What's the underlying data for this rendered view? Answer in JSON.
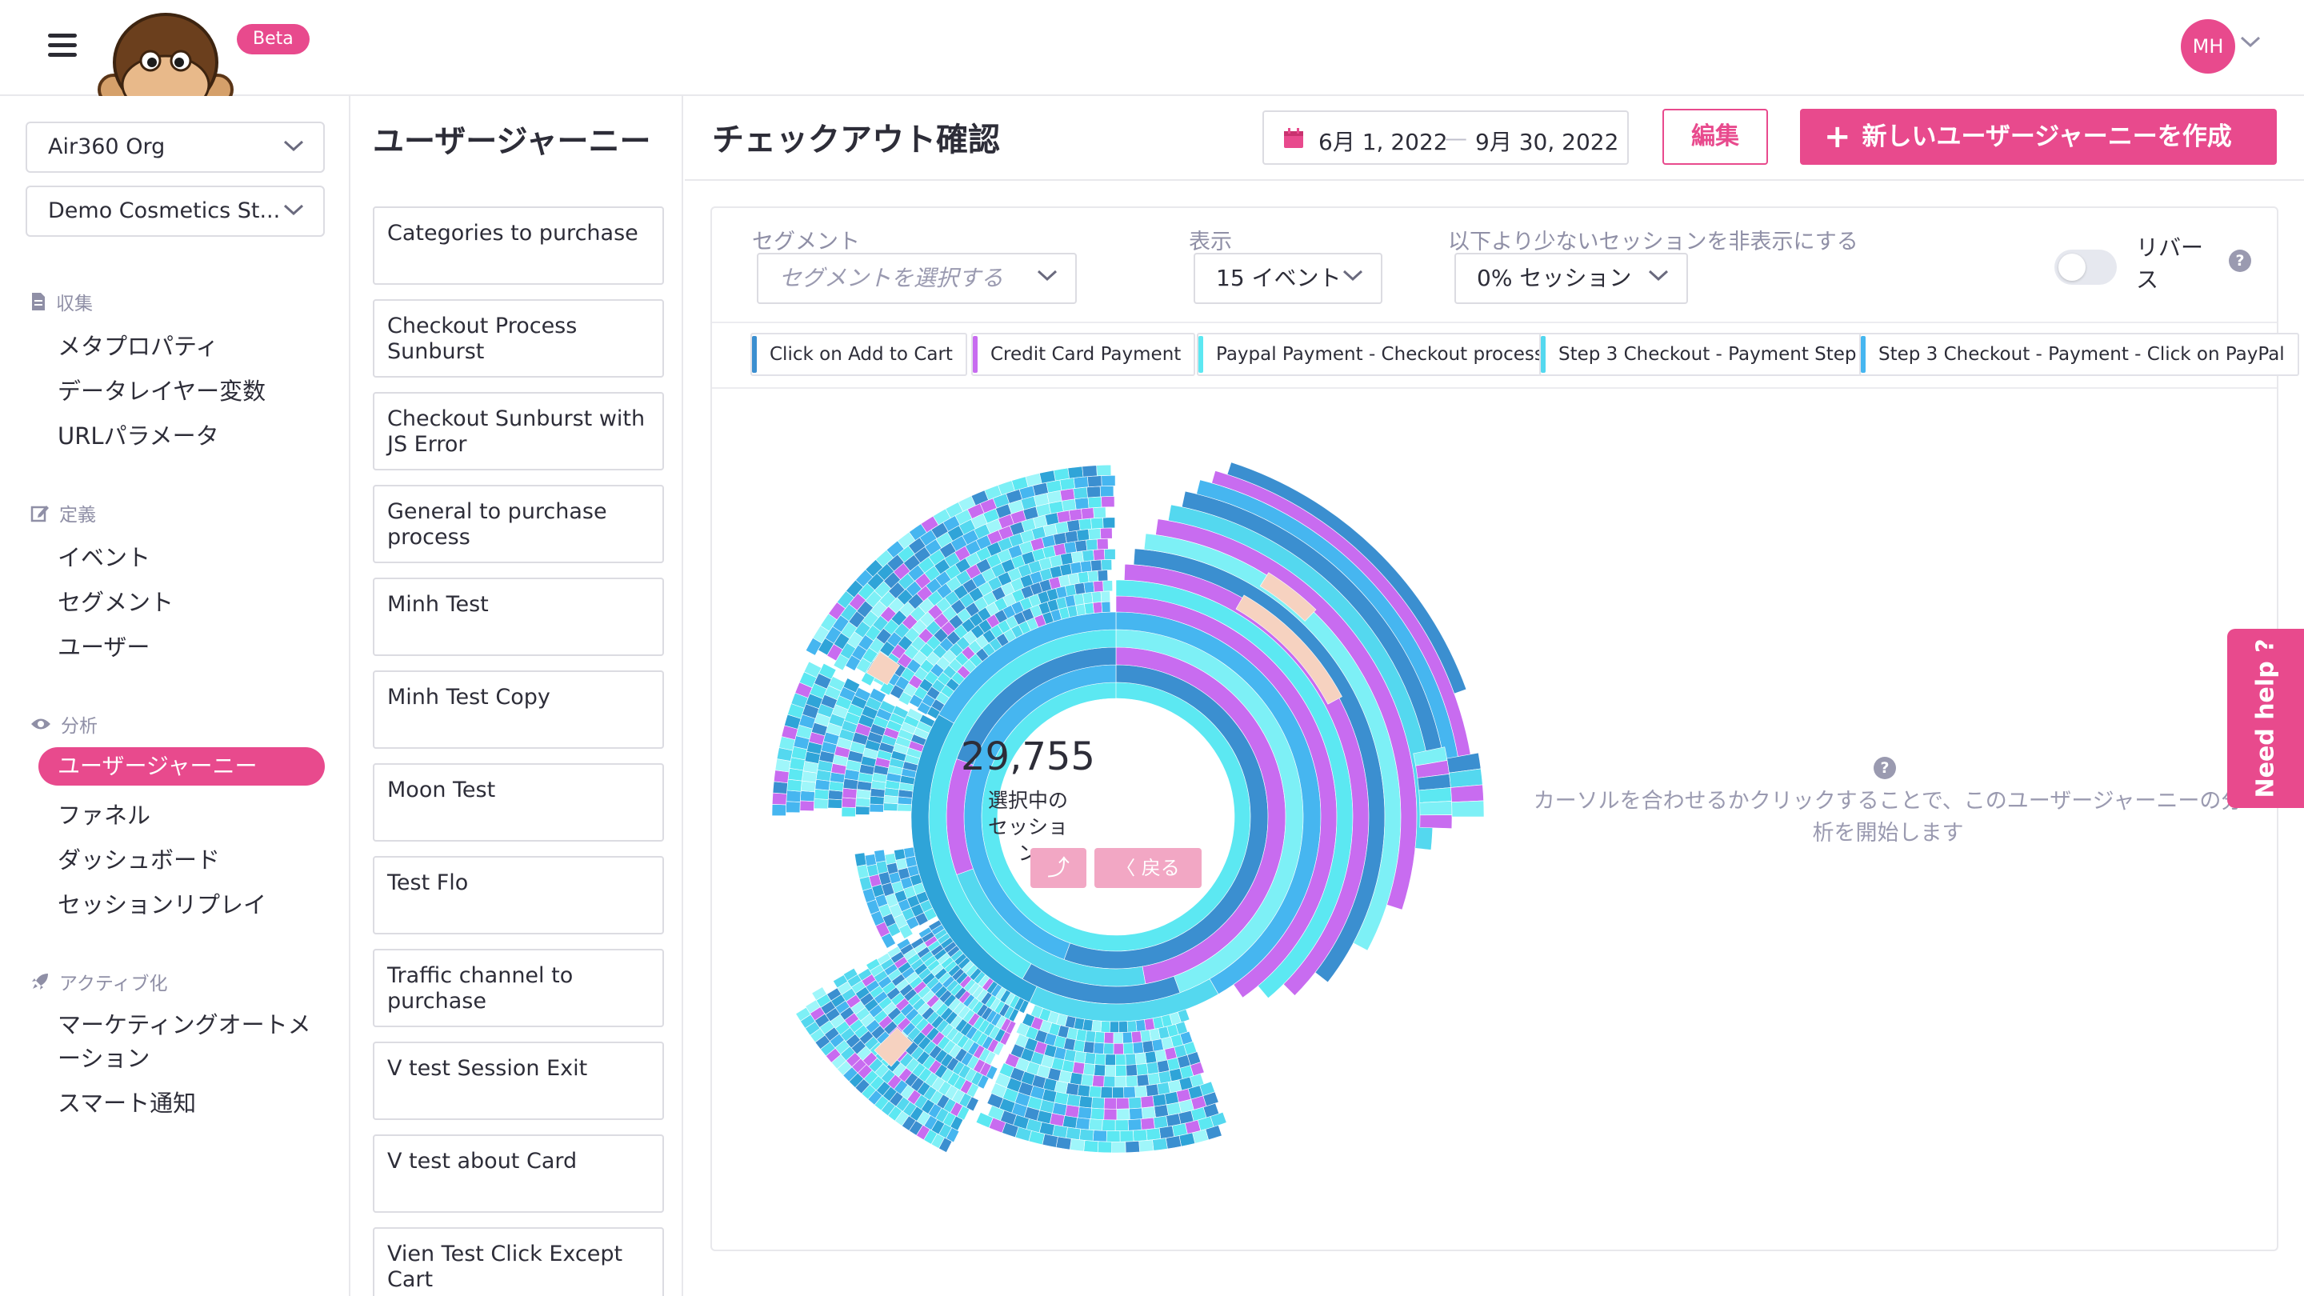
{
  "brand": {
    "badge": "Beta",
    "accent_color": "#e84a8d"
  },
  "user": {
    "initials": "MH"
  },
  "sidebar": {
    "org_select": "Air360 Org",
    "site_select": "Demo Cosmetics St...",
    "sections": [
      {
        "title": "収集",
        "icon": "document-icon",
        "items": [
          "メタプロパティ",
          "データレイヤー変数",
          "URLパラメータ"
        ]
      },
      {
        "title": "定義",
        "icon": "edit-icon",
        "items": [
          "イベント",
          "セグメント",
          "ユーザー"
        ]
      },
      {
        "title": "分析",
        "icon": "eye-icon",
        "items": [
          "ユーザージャーニー",
          "ファネル",
          "ダッシュボード",
          "セッションリプレイ"
        ],
        "active": "ユーザージャーニー"
      },
      {
        "title": "アクティブ化",
        "icon": "rocket-icon",
        "items": [
          "マーケティングオートメーション",
          "スマート通知"
        ]
      }
    ]
  },
  "journeys": {
    "title": "ユーザージャーニー",
    "items": [
      "Categories to purchase",
      "Checkout Process Sunburst",
      "Checkout Sunburst with JS Error",
      "General to purchase process",
      "Minh Test",
      "Minh Test Copy",
      "Moon Test",
      "Test Flo",
      "Traffic channel to purchase",
      "V test Session Exit",
      "V test about Card",
      "Vien Test Click Except Cart"
    ]
  },
  "main": {
    "title": "チェックアウト確認",
    "date_start": "6月 1, 2022",
    "date_end": "9月 30, 2022",
    "date_separator": "—",
    "edit_label": "編集",
    "new_label": "新しいユーザージャーニーを作成"
  },
  "filters": {
    "segment_label": "セグメント",
    "segment_placeholder": "セグメントを選択する",
    "display_label": "表示",
    "display_value": "15 イベント",
    "hide_label": "以下より少ないセッションを非表示にする",
    "hide_value": "0% セッション",
    "reverse_label": "リバース",
    "reverse_on": false
  },
  "legend": [
    {
      "label": "Click on Add to Cart",
      "color": "#3b8fd0"
    },
    {
      "label": "Credit Card Payment",
      "color": "#c86cf0"
    },
    {
      "label": "Paypal Payment - Checkout process",
      "color": "#5ce8f2"
    },
    {
      "label": "Step 3 Checkout - Payment Step",
      "color": "#54d8ef"
    },
    {
      "label": "Step 3 Checkout - Payment - Click on PayPal",
      "color": "#46b6f0"
    }
  ],
  "chart": {
    "sessions": "29,755",
    "sessions_label": "選択中のセッション",
    "up_label": "⤴",
    "back_label": "〈 戻る"
  },
  "hint": "カーソルを合わせるかクリックすることで、このユーザージャーニーの分析を開始します",
  "help": {
    "label": "Need help ?"
  }
}
